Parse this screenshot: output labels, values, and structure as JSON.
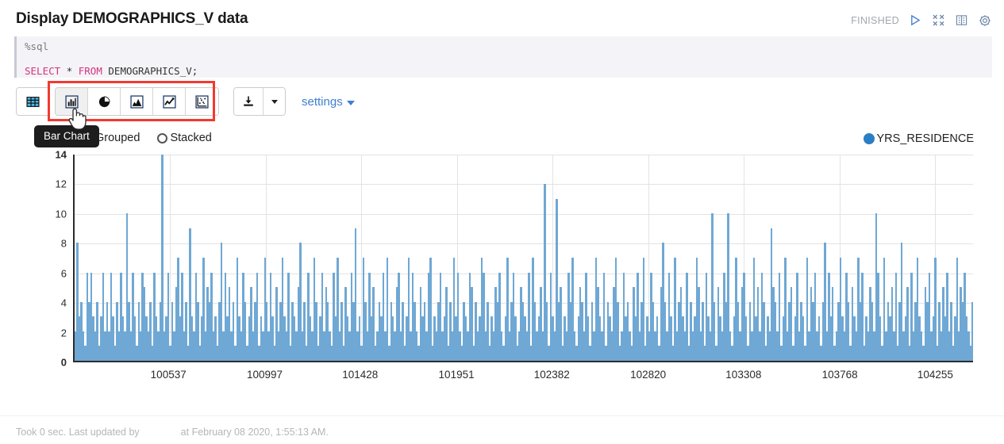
{
  "header": {
    "title": "Display DEMOGRAPHICS_V data",
    "status": "FINISHED",
    "icons": [
      {
        "name": "run-icon",
        "glyph": "play"
      },
      {
        "name": "collapse-icon",
        "glyph": "collapse"
      },
      {
        "name": "book-icon",
        "glyph": "book"
      },
      {
        "name": "gear-icon",
        "glyph": "gear"
      }
    ]
  },
  "editor": {
    "interpreter": "%sql",
    "code_tokens": [
      {
        "text": "SELECT",
        "type": "keyword"
      },
      {
        "text": " ",
        "type": "plain"
      },
      {
        "text": "*",
        "type": "operator"
      },
      {
        "text": " ",
        "type": "plain"
      },
      {
        "text": "FROM",
        "type": "keyword"
      },
      {
        "text": " ",
        "type": "plain"
      },
      {
        "text": "DEMOGRAPHICS_V;",
        "type": "identifier"
      }
    ],
    "code_plain": "SELECT * FROM DEMOGRAPHICS_V;"
  },
  "toolbar": {
    "table_button": {
      "name": "table-view-button",
      "label": "Table"
    },
    "chart_buttons": [
      {
        "name": "bar-chart-button",
        "label": "Bar Chart",
        "active": true
      },
      {
        "name": "pie-chart-button",
        "label": "Pie Chart",
        "active": false
      },
      {
        "name": "area-chart-button",
        "label": "Area Chart",
        "active": false
      },
      {
        "name": "line-chart-button",
        "label": "Line Chart",
        "active": false
      },
      {
        "name": "scatter-chart-button",
        "label": "Scatter Chart",
        "active": false
      }
    ],
    "download_button_label": "Download",
    "settings_label": "settings",
    "tooltip": "Bar Chart",
    "highlight_color": "#f4392f"
  },
  "chart_modes": [
    {
      "label": "Grouped",
      "selected": true
    },
    {
      "label": "Stacked",
      "selected": false
    }
  ],
  "legend": [
    {
      "label": "YRS_RESIDENCE",
      "color": "#2a7fc4"
    }
  ],
  "footer": {
    "text_before": "Took 0 sec. Last updated by",
    "user": "",
    "text_after": "at February 08 2020, 1:55:13 AM."
  },
  "chart_data": {
    "type": "bar",
    "title": "",
    "xlabel": "",
    "ylabel": "",
    "ylim": [
      0,
      14
    ],
    "yticks": [
      0,
      2,
      4,
      6,
      8,
      10,
      12,
      14
    ],
    "grid": true,
    "legend_position": "top-right",
    "series": [
      {
        "name": "YRS_RESIDENCE",
        "color": "#6fa8d4",
        "values": [
          2,
          8,
          3,
          4,
          2,
          1,
          6,
          4,
          6,
          3,
          2,
          4,
          1,
          3,
          6,
          2,
          4,
          2,
          6,
          3,
          1,
          4,
          2,
          6,
          3,
          2,
          10,
          4,
          2,
          6,
          3,
          1,
          4,
          2,
          6,
          5,
          3,
          2,
          4,
          1,
          6,
          3,
          2,
          4,
          14,
          2,
          3,
          6,
          1,
          4,
          2,
          5,
          7,
          3,
          6,
          2,
          4,
          1,
          9,
          3,
          2,
          6,
          4,
          1,
          3,
          7,
          2,
          5,
          4,
          6,
          2,
          3,
          1,
          4,
          8,
          2,
          6,
          3,
          5,
          2,
          4,
          1,
          7,
          3,
          2,
          6,
          4,
          1,
          3,
          5,
          2,
          4,
          6,
          1,
          3,
          2,
          7,
          4,
          2,
          6,
          3,
          1,
          5,
          2,
          4,
          7,
          3,
          2,
          6,
          1,
          4,
          3,
          2,
          5,
          8,
          2,
          4,
          1,
          6,
          3,
          2,
          7,
          4,
          1,
          3,
          6,
          2,
          5,
          4,
          2,
          1,
          6,
          3,
          7,
          2,
          4,
          1,
          5,
          3,
          2,
          6,
          4,
          9,
          2,
          3,
          1,
          7,
          4,
          2,
          6,
          3,
          5,
          1,
          2,
          4,
          3,
          6,
          2,
          7,
          1,
          4,
          3,
          2,
          5,
          6,
          2,
          4,
          1,
          3,
          7,
          2,
          6,
          4,
          2,
          1,
          5,
          3,
          4,
          2,
          6,
          7,
          1,
          3,
          2,
          4,
          6,
          2,
          3,
          5,
          1,
          4,
          2,
          7,
          3,
          6,
          2,
          1,
          4,
          3,
          2,
          6,
          5,
          1,
          4,
          2,
          3,
          7,
          6,
          2,
          4,
          1,
          3,
          2,
          5,
          4,
          6,
          2,
          1,
          3,
          7,
          2,
          4,
          6,
          3,
          1,
          2,
          5,
          4,
          3,
          2,
          6,
          1,
          7,
          4,
          2,
          3,
          5,
          2,
          12,
          4,
          1,
          6,
          3,
          2,
          11,
          4,
          5,
          1,
          3,
          2,
          6,
          4,
          7,
          2,
          1,
          3,
          5,
          4,
          2,
          6,
          3,
          1,
          4,
          2,
          7,
          5,
          3,
          2,
          6,
          1,
          4,
          3,
          2,
          5,
          7,
          4,
          1,
          2,
          6,
          3,
          4,
          2,
          1,
          5,
          3,
          6,
          2,
          4,
          7,
          1,
          3,
          2,
          6,
          4,
          2,
          3,
          1,
          5,
          8,
          4,
          2,
          6,
          3,
          1,
          7,
          2,
          4,
          5,
          3,
          2,
          6,
          1,
          4,
          2,
          3,
          7,
          5,
          2,
          4,
          1,
          6,
          3,
          2,
          10,
          4,
          1,
          5,
          3,
          2,
          6,
          4,
          10,
          2,
          1,
          3,
          7,
          4,
          2,
          5,
          6,
          3,
          1,
          4,
          2,
          7,
          3,
          5,
          2,
          6,
          4,
          1,
          3,
          2,
          9,
          5,
          4,
          2,
          6,
          1,
          3,
          7,
          2,
          4,
          5,
          1,
          3,
          6,
          2,
          4,
          3,
          1,
          7,
          2,
          5,
          4,
          6,
          2,
          3,
          1,
          4,
          8,
          2,
          6,
          3,
          5,
          1,
          2,
          4,
          7,
          3,
          2,
          6,
          4,
          1,
          5,
          3,
          2,
          7,
          4,
          6,
          1,
          3,
          2,
          5,
          4,
          2,
          10,
          6,
          3,
          1,
          7,
          2,
          4,
          3,
          5,
          2,
          6,
          1,
          4,
          8,
          2,
          3,
          5,
          1,
          6,
          2,
          4,
          7,
          3,
          2,
          1,
          5,
          4,
          6,
          2,
          3,
          7,
          1,
          4,
          2,
          5,
          3,
          6,
          2,
          4,
          1,
          3,
          7,
          2,
          5,
          4,
          6,
          3,
          2,
          1,
          4,
          7
        ]
      }
    ],
    "xticks": [
      {
        "label": "100537",
        "pos_pct": 10.6
      },
      {
        "label": "100997",
        "pos_pct": 21.3
      },
      {
        "label": "101428",
        "pos_pct": 31.9
      },
      {
        "label": "101951",
        "pos_pct": 42.6
      },
      {
        "label": "102382",
        "pos_pct": 53.2
      },
      {
        "label": "102820",
        "pos_pct": 63.9
      },
      {
        "label": "103308",
        "pos_pct": 74.5
      },
      {
        "label": "103768",
        "pos_pct": 85.2
      },
      {
        "label": "104255",
        "pos_pct": 95.8
      }
    ]
  }
}
